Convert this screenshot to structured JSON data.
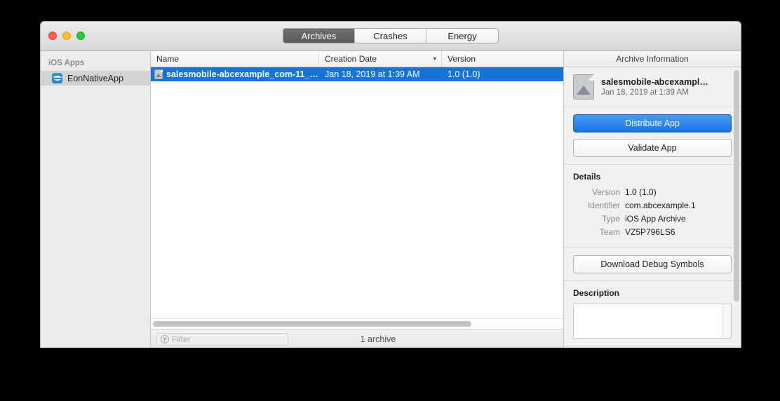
{
  "window": {
    "traffic_lights": [
      "close",
      "minimize",
      "zoom"
    ]
  },
  "toolbar": {
    "tabs": [
      {
        "label": "Archives",
        "active": true
      },
      {
        "label": "Crashes",
        "active": false
      },
      {
        "label": "Energy",
        "active": false
      }
    ]
  },
  "sidebar": {
    "group_title": "iOS Apps",
    "items": [
      {
        "label": "EonNativeApp",
        "selected": true
      }
    ]
  },
  "table": {
    "columns": [
      {
        "label": "Name"
      },
      {
        "label": "Creation Date",
        "sorted": "descending"
      },
      {
        "label": "Version"
      }
    ],
    "rows": [
      {
        "name": "salesmobile-abcexample_com-11_0…",
        "creation_date": "Jan 18, 2019 at 1:39 AM",
        "version": "1.0 (1.0)",
        "selected": true
      }
    ]
  },
  "status": {
    "filter_placeholder": "Filter",
    "count_label": "1 archive"
  },
  "inspector": {
    "title": "Archive Information",
    "archive": {
      "name": "salesmobile-abcexampl…",
      "date": "Jan 18, 2019 at 1:39 AM"
    },
    "actions": {
      "distribute": "Distribute App",
      "validate": "Validate App",
      "download_symbols": "Download Debug Symbols"
    },
    "details": {
      "title": "Details",
      "rows": [
        {
          "label": "Version",
          "value": "1.0 (1.0)"
        },
        {
          "label": "Identifier",
          "value": "com.abcexample.1"
        },
        {
          "label": "Type",
          "value": "iOS App Archive"
        },
        {
          "label": "Team",
          "value": "VZ5P796LS6"
        }
      ]
    },
    "description": {
      "title": "Description",
      "value": ""
    }
  },
  "colors": {
    "selection_blue": "#1673d8",
    "primary_button": "#1a72e8",
    "window_chrome": "#ececec"
  }
}
